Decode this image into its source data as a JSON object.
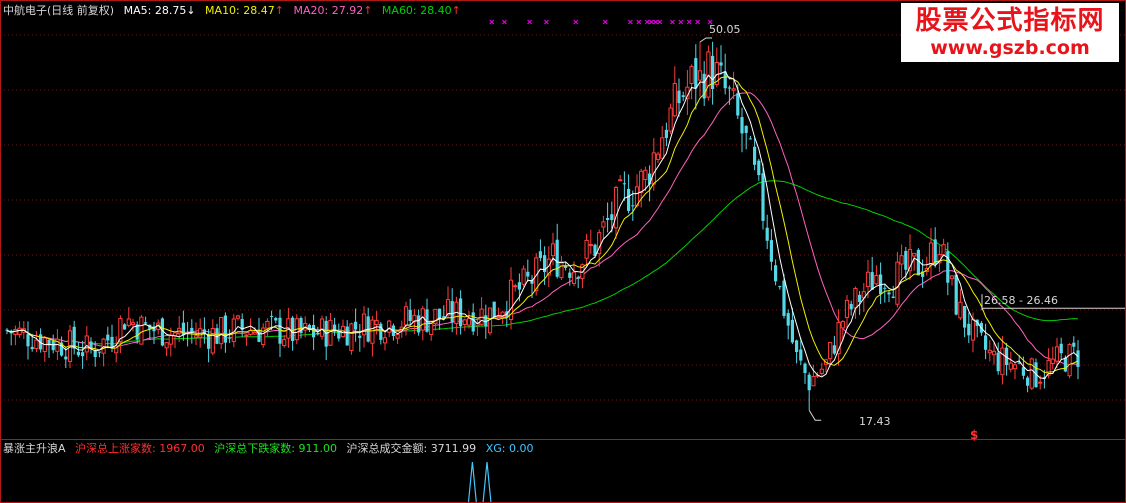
{
  "header": {
    "stock_name": "中航电子(日线 前复权)",
    "ma5": {
      "label": "MA5:",
      "value": "28.75",
      "arrow": "↓",
      "color": "#ffffff"
    },
    "ma10": {
      "label": "MA10:",
      "value": "28.47",
      "arrow": "↑",
      "color": "#f0f000"
    },
    "ma20": {
      "label": "MA20:",
      "value": "27.92",
      "arrow": "↑",
      "color": "#ff60c0"
    },
    "ma60": {
      "label": "MA60:",
      "value": "28.40",
      "arrow": "↑",
      "color": "#00d000"
    }
  },
  "watermark": {
    "cn": "股票公式指标网",
    "url": "www.gszb.com"
  },
  "annotations": {
    "high_label": "50.05",
    "low_label": "17.43",
    "range_label": "26.58 - 26.46",
    "signal_mark": "$"
  },
  "sub_header": {
    "indicator_name": "暴涨主升浪A",
    "up_count": {
      "label": "沪深总上涨家数:",
      "value": "1967.00"
    },
    "down_count": {
      "label": "沪深总下跌家数:",
      "value": "911.00"
    },
    "turnover": {
      "label": "沪深总成交金额:",
      "value": "3711.99"
    },
    "xg": {
      "label": "XG:",
      "value": "0.00"
    }
  },
  "colors": {
    "background": "#000000",
    "frame": "#b01818",
    "up_candle": "#ff3c3c",
    "down_candle": "#54d8e8",
    "ma5": "#ffffff",
    "ma10": "#f0f000",
    "ma20": "#ff60c0",
    "ma60": "#00d000",
    "marker": "#e000e0"
  },
  "chart_data": {
    "type": "candlestick",
    "price_range": [
      15.5,
      52
    ],
    "approx_close_path": [
      [
        0,
        24.5
      ],
      [
        10,
        23.6
      ],
      [
        20,
        22.7
      ],
      [
        25,
        24.0
      ],
      [
        28,
        25.6
      ],
      [
        32,
        24.8
      ],
      [
        40,
        24.2
      ],
      [
        50,
        24.2
      ],
      [
        55,
        24.6
      ],
      [
        62,
        24.6
      ],
      [
        70,
        24.1
      ],
      [
        80,
        24.6
      ],
      [
        90,
        25.2
      ],
      [
        100,
        25.6
      ],
      [
        108,
        25.9
      ],
      [
        115,
        26.0
      ],
      [
        125,
        29.0
      ],
      [
        130,
        31.0
      ],
      [
        135,
        30.2
      ],
      [
        140,
        32.0
      ],
      [
        146,
        36.0
      ],
      [
        152,
        38.0
      ],
      [
        156,
        42.0
      ],
      [
        160,
        45.0
      ],
      [
        164,
        47.0
      ],
      [
        168,
        47.6
      ],
      [
        172,
        45.0
      ],
      [
        176,
        41.0
      ],
      [
        180,
        35.0
      ],
      [
        184,
        28.0
      ],
      [
        188,
        22.0
      ],
      [
        191,
        20.0
      ],
      [
        195,
        21.5
      ],
      [
        199,
        25.5
      ],
      [
        203,
        27.5
      ],
      [
        207,
        29.5
      ],
      [
        211,
        29.0
      ],
      [
        215,
        30.0
      ],
      [
        219,
        30.5
      ],
      [
        222,
        32.5
      ],
      [
        224,
        29.0
      ],
      [
        227,
        26.0
      ],
      [
        231,
        23.5
      ],
      [
        235,
        22.0
      ],
      [
        240,
        21.5
      ],
      [
        245,
        20.5
      ],
      [
        250,
        21.8
      ],
      [
        254,
        22.3
      ]
    ],
    "key_points": {
      "high": 50.05,
      "low": 17.43,
      "range_low": 26.46,
      "range_high": 26.58
    },
    "overlays": [
      "MA5",
      "MA10",
      "MA20",
      "MA60"
    ],
    "sub_chart": {
      "series": "XG",
      "value": 0.0,
      "spike_positions": [
        117,
        120
      ]
    }
  }
}
